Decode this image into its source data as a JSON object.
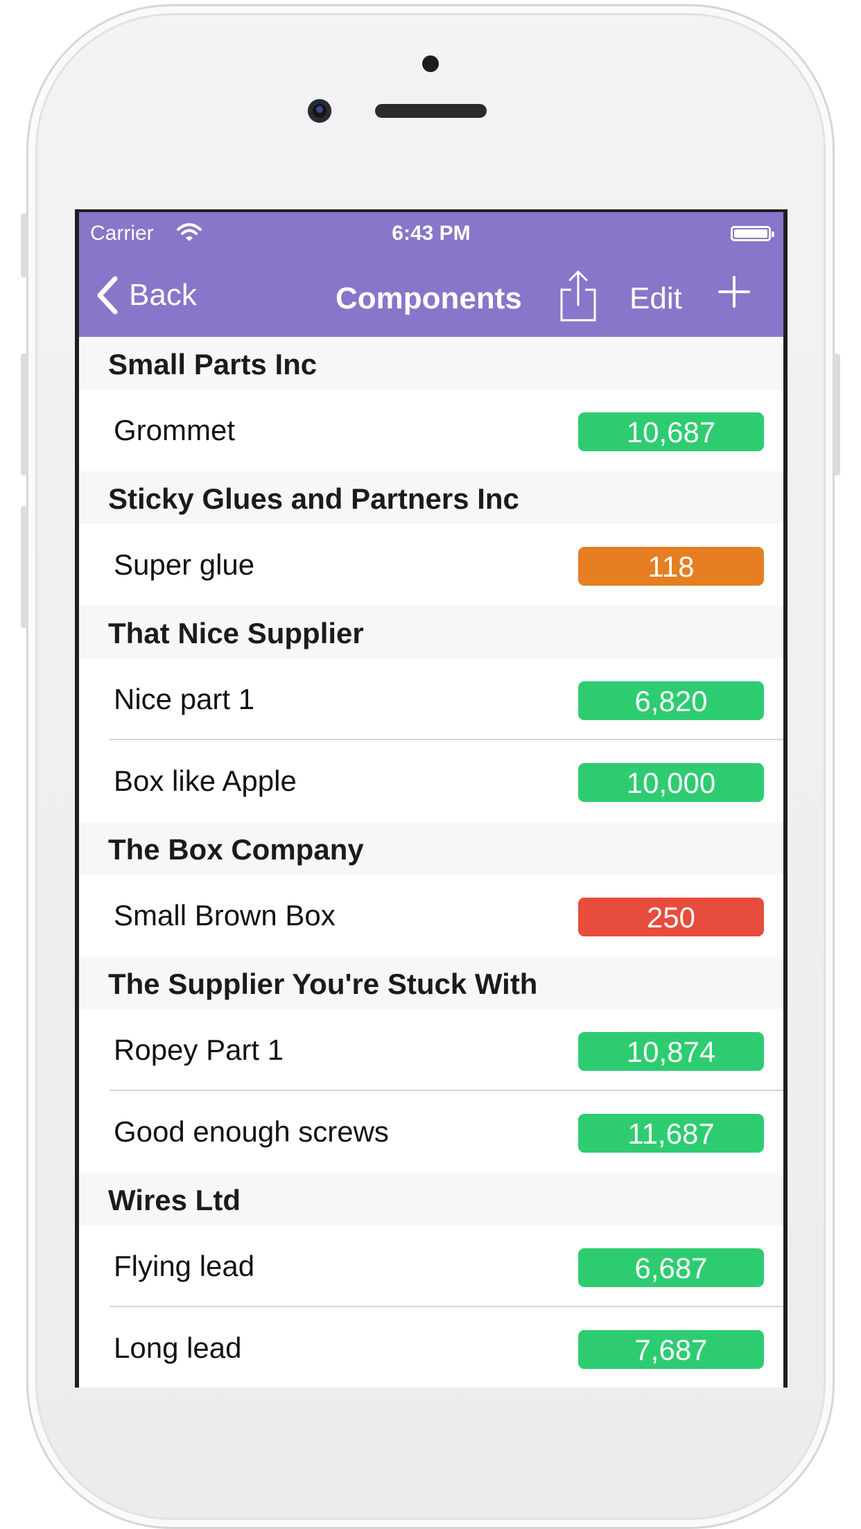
{
  "status_bar": {
    "carrier": "Carrier",
    "time": "6:43 PM"
  },
  "nav": {
    "back_label": "Back",
    "title": "Components",
    "edit_label": "Edit"
  },
  "colors": {
    "nav_bg": "#8776c9",
    "green": "#2ecc71",
    "orange": "#e67e22",
    "red": "#e74c3c"
  },
  "sections": [
    {
      "header": "Small Parts Inc",
      "items": [
        {
          "name": "Grommet",
          "stock": "10,687",
          "status": "green"
        }
      ]
    },
    {
      "header": "Sticky Glues and Partners Inc",
      "items": [
        {
          "name": "Super glue",
          "stock": "118",
          "status": "orange"
        }
      ]
    },
    {
      "header": "That Nice Supplier",
      "items": [
        {
          "name": "Nice part 1",
          "stock": "6,820",
          "status": "green"
        },
        {
          "name": "Box like Apple",
          "stock": "10,000",
          "status": "green"
        }
      ]
    },
    {
      "header": "The Box Company",
      "items": [
        {
          "name": "Small Brown Box",
          "stock": "250",
          "status": "red"
        }
      ]
    },
    {
      "header": "The Supplier You're Stuck With",
      "items": [
        {
          "name": "Ropey Part 1",
          "stock": "10,874",
          "status": "green"
        },
        {
          "name": "Good enough screws",
          "stock": "11,687",
          "status": "green"
        }
      ]
    },
    {
      "header": "Wires Ltd",
      "items": [
        {
          "name": "Flying lead",
          "stock": "6,687",
          "status": "green"
        },
        {
          "name": "Long lead",
          "stock": "7,687",
          "status": "green"
        }
      ]
    }
  ]
}
